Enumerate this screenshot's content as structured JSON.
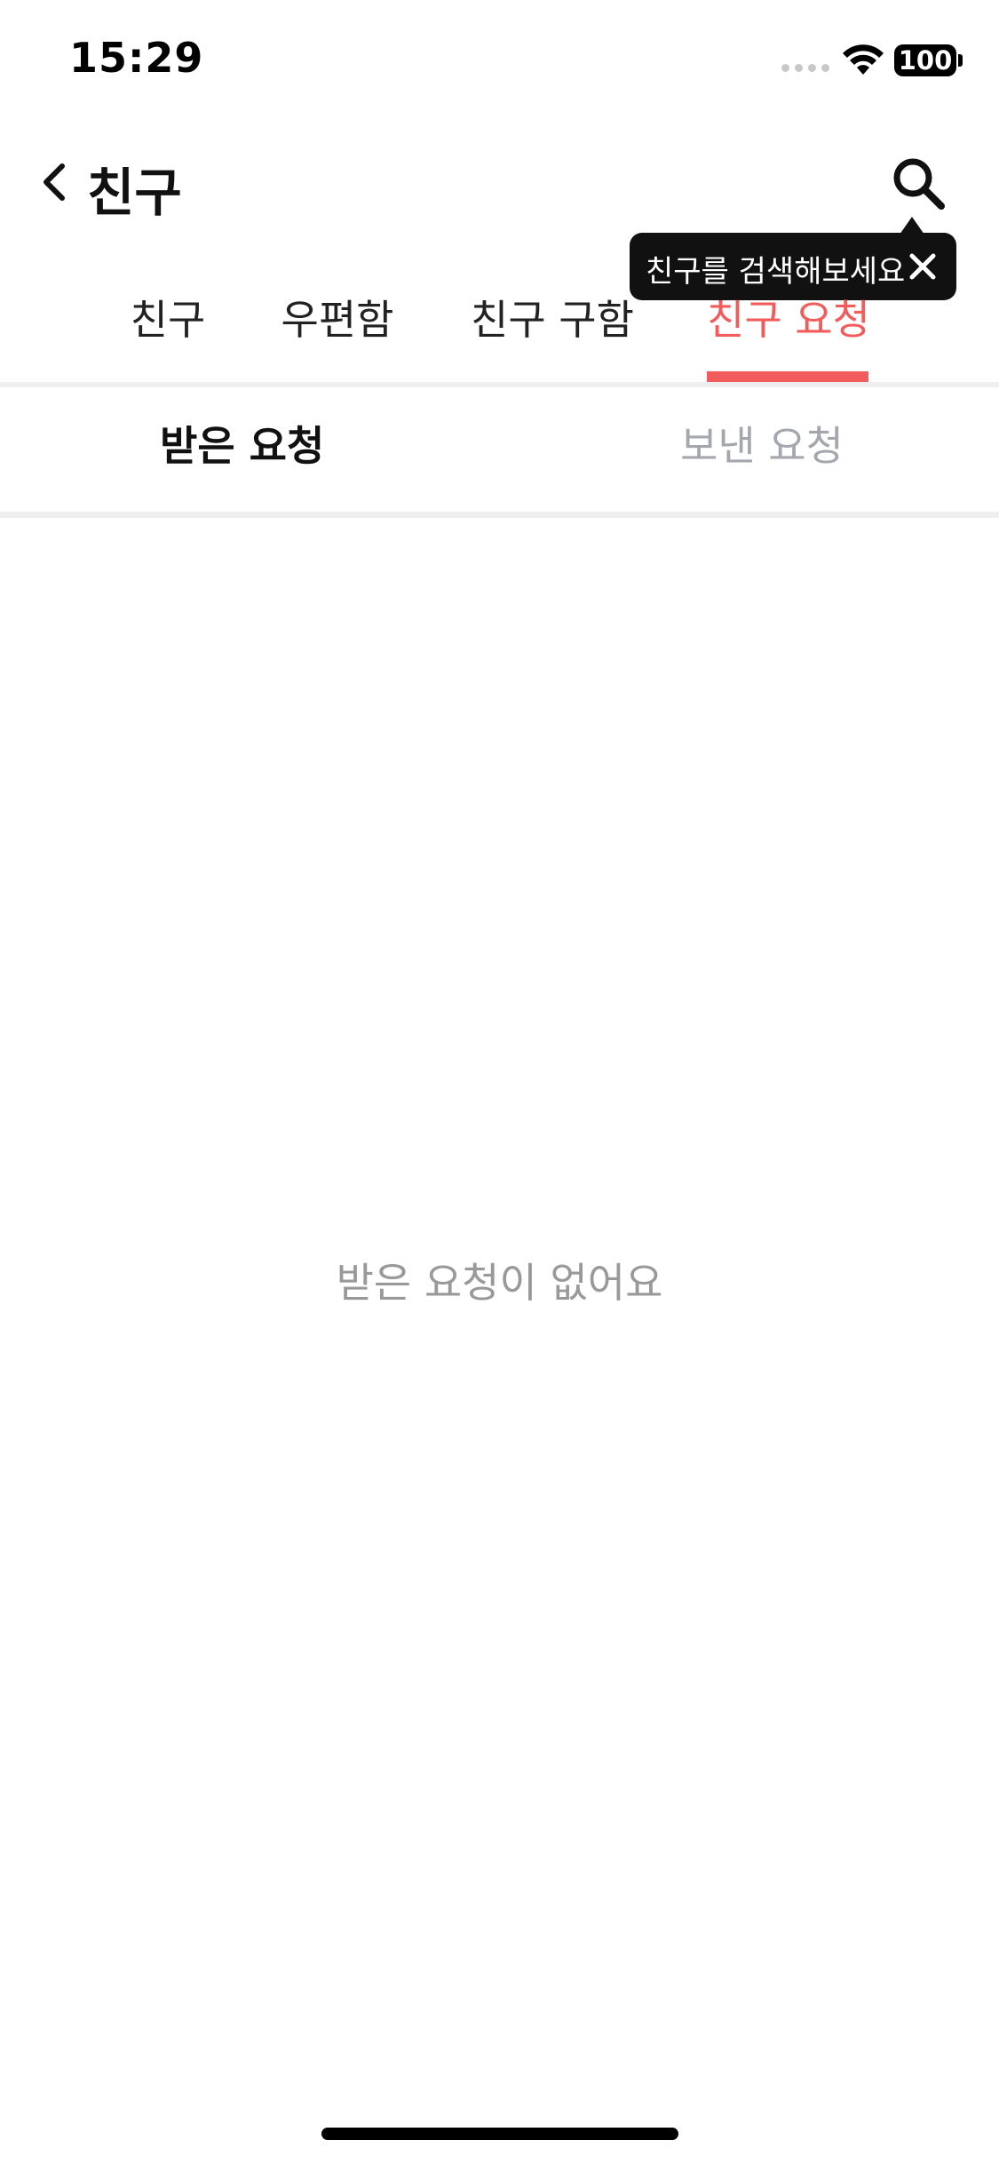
{
  "status_bar": {
    "time": "15:29",
    "battery_level": "100"
  },
  "header": {
    "title": "친구"
  },
  "tooltip": {
    "text": "친구를 검색해보세요"
  },
  "main_tabs": [
    {
      "label": "친구",
      "active": false
    },
    {
      "label": "우편함",
      "active": false
    },
    {
      "label": "친구 구함",
      "active": false
    },
    {
      "label": "친구 요청",
      "active": true
    }
  ],
  "sub_tabs": [
    {
      "label": "받은 요청",
      "selected": true
    },
    {
      "label": "보낸 요청",
      "selected": false
    }
  ],
  "empty_state": {
    "message": "받은 요청이 없어요"
  },
  "colors": {
    "accent": "#f25c5c",
    "inactive_text": "#a4a8ae",
    "empty_text": "#999999",
    "tooltip_bg": "#111111",
    "divider": "#efefef"
  },
  "icons": {
    "back": "chevron-left-icon",
    "search": "search-icon",
    "close": "close-icon",
    "wifi": "wifi-icon",
    "battery": "battery-icon"
  }
}
